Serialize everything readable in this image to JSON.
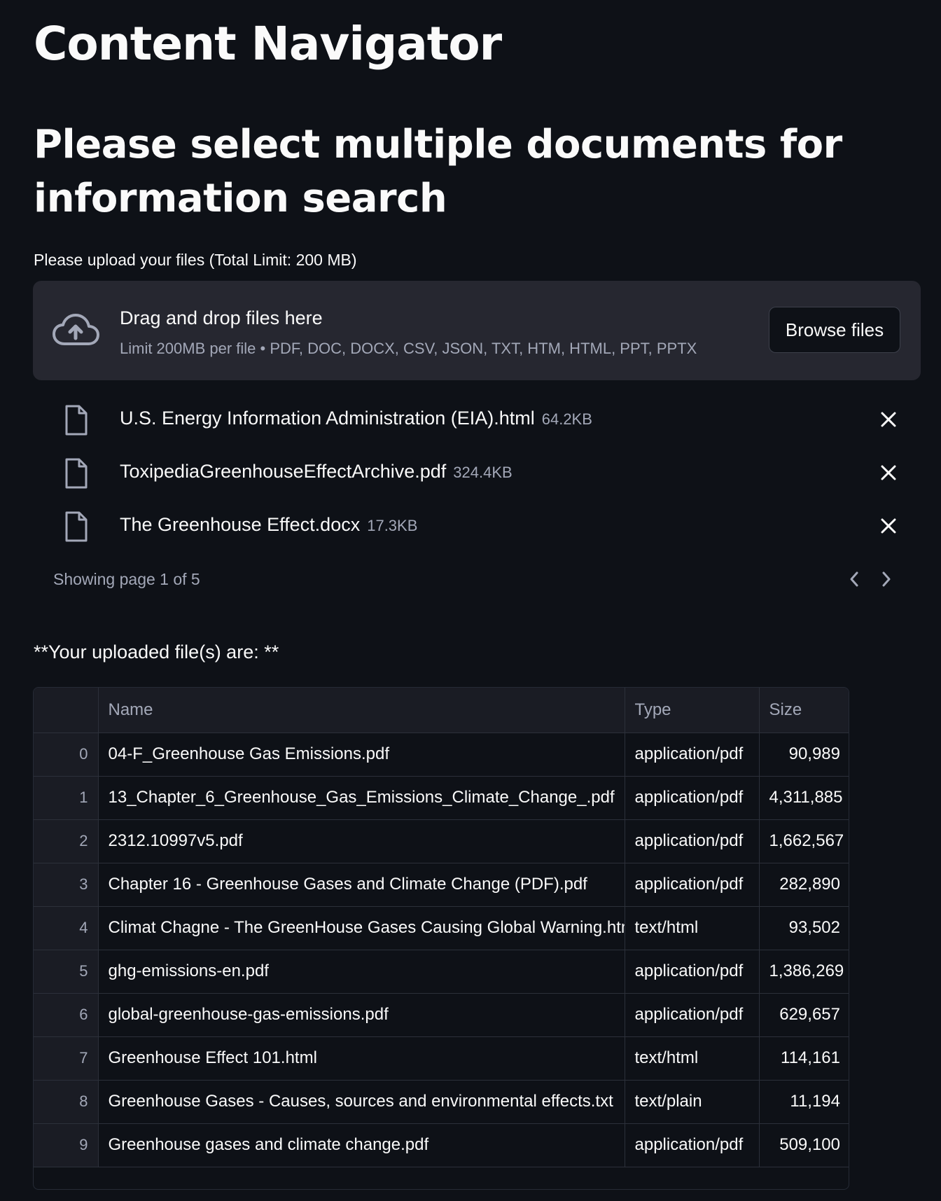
{
  "app": {
    "title": "Content Navigator"
  },
  "section": {
    "title": "Please select multiple documents for information search"
  },
  "uploader": {
    "label": "Please upload your files (Total Limit: 200 MB)",
    "drop_title": "Drag and drop files here",
    "drop_limit": "Limit 200MB per file • PDF, DOC, DOCX, CSV, JSON, TXT, HTM, HTML, PPT, PPTX",
    "browse_label": "Browse files",
    "icon": "cloud-upload-icon"
  },
  "files": [
    {
      "name": "U.S. Energy Information Administration (EIA).html",
      "size": "64.2KB"
    },
    {
      "name": "ToxipediaGreenhouseEffectArchive.pdf",
      "size": "324.4KB"
    },
    {
      "name": "The Greenhouse Effect.docx",
      "size": "17.3KB"
    }
  ],
  "pager": {
    "text": "Showing page 1 of 5"
  },
  "uploaded": {
    "heading": "**Your uploaded file(s) are: **"
  },
  "table": {
    "columns": [
      "",
      "Name",
      "Type",
      "Size"
    ],
    "rows": [
      {
        "index": "0",
        "name": "04-F_Greenhouse Gas Emissions.pdf",
        "type": "application/pdf",
        "size": "90,989"
      },
      {
        "index": "1",
        "name": "13_Chapter_6_Greenhouse_Gas_Emissions_Climate_Change_.pdf",
        "type": "application/pdf",
        "size": "4,311,885"
      },
      {
        "index": "2",
        "name": "2312.10997v5.pdf",
        "type": "application/pdf",
        "size": "1,662,567"
      },
      {
        "index": "3",
        "name": "Chapter 16 - Greenhouse Gases and Climate Change (PDF).pdf",
        "type": "application/pdf",
        "size": "282,890"
      },
      {
        "index": "4",
        "name": "Climat Chagne - The GreenHouse Gases Causing Global Warning.html",
        "type": "text/html",
        "size": "93,502"
      },
      {
        "index": "5",
        "name": "ghg-emissions-en.pdf",
        "type": "application/pdf",
        "size": "1,386,269"
      },
      {
        "index": "6",
        "name": "global-greenhouse-gas-emissions.pdf",
        "type": "application/pdf",
        "size": "629,657"
      },
      {
        "index": "7",
        "name": "Greenhouse Effect 101.html",
        "type": "text/html",
        "size": "114,161"
      },
      {
        "index": "8",
        "name": "Greenhouse Gases - Causes, sources and environmental effects.txt",
        "type": "text/plain",
        "size": "11,194"
      },
      {
        "index": "9",
        "name": "Greenhouse gases and climate change.pdf",
        "type": "application/pdf",
        "size": "509,100"
      }
    ]
  },
  "colors": {
    "background": "#0e1117",
    "panel": "#262730",
    "text": "#fafafa",
    "muted": "#a3a8b8",
    "border": "#2c303a"
  }
}
